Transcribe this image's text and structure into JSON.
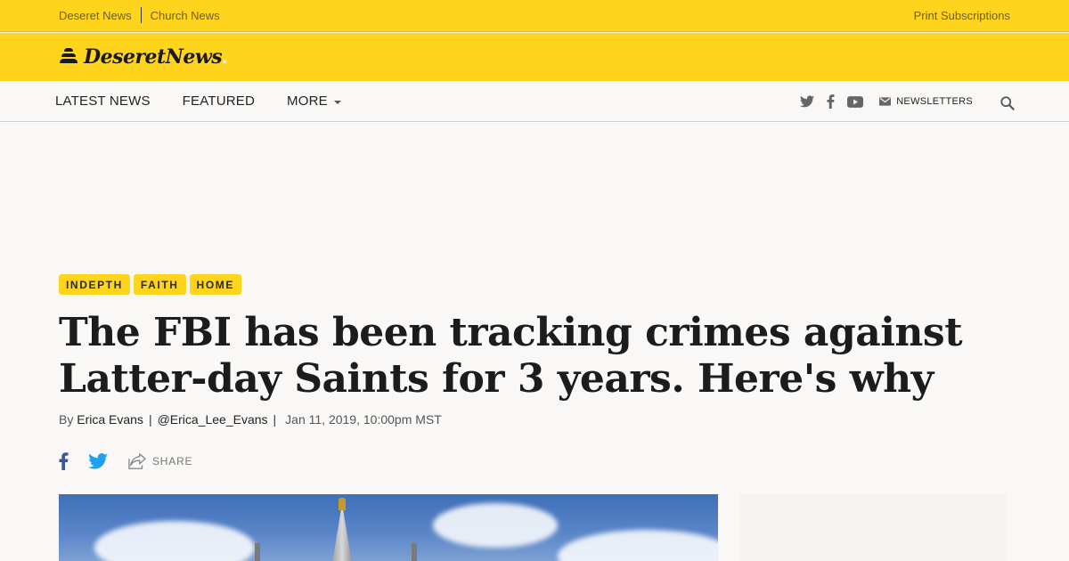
{
  "utility": {
    "left_links": [
      "Deseret News",
      "Church News"
    ],
    "right_link": "Print Subscriptions"
  },
  "brand": {
    "name": "DeseretNews",
    "accent_color": "#ffd41d"
  },
  "nav": {
    "items": [
      "LATEST NEWS",
      "FEATURED",
      "MORE"
    ],
    "social_icons": [
      "twitter-icon",
      "facebook-icon",
      "youtube-icon"
    ],
    "newsletters_label": "NEWSLETTERS",
    "search_icon": "search-icon"
  },
  "article": {
    "tags": [
      "INDEPTH",
      "FAITH",
      "HOME"
    ],
    "headline": "The FBI has been tracking crimes against Latter-day Saints for 3 years. Here's why",
    "byline_prefix": "By",
    "author": "Erica Evans",
    "handle": "@Erica_Lee_Evans",
    "date": "Jan 11, 2019, 10:00pm MST",
    "share_label": "SHARE"
  }
}
